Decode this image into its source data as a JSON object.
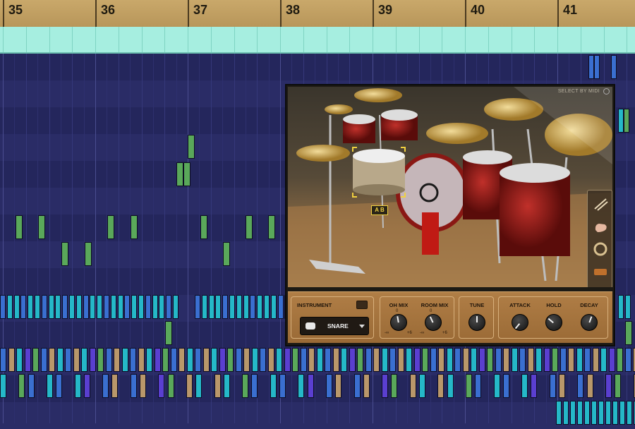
{
  "timeline": {
    "bars": [
      "35",
      "36",
      "37",
      "38",
      "39",
      "40",
      "41"
    ]
  },
  "plugin": {
    "top_label": "SELECT BY MIDI",
    "ab_label": "A B",
    "instrument": {
      "header": "INSTRUMENT",
      "selected": "SNARE"
    },
    "mix": {
      "oh_label": "OH MIX",
      "room_label": "ROOM MIX",
      "scale_min": "-∞",
      "scale_max": "+6",
      "scale_zero": "0"
    },
    "tune_label": "TUNE",
    "attack_label": "ATTACK",
    "hold_label": "HOLD",
    "decay_label": "DECAY"
  },
  "icons": {
    "instrument_icon": "snare-drum-icon",
    "dropdown_icon": "caret-down-icon",
    "tool_icons": [
      "sticks-icon",
      "hand-icon",
      "tambourine-icon",
      "shaker-icon"
    ],
    "header_icon": "monitor-icon"
  },
  "colors": {
    "ruler": "#c9a86a",
    "region": "#a6eee0",
    "grid_bg": "#23255a",
    "note_green": "#5aa85a",
    "note_cyan": "#25b8c8",
    "note_blue": "#3a6fd0",
    "note_purple": "#5a3fd0",
    "note_tan": "#b9976a"
  }
}
